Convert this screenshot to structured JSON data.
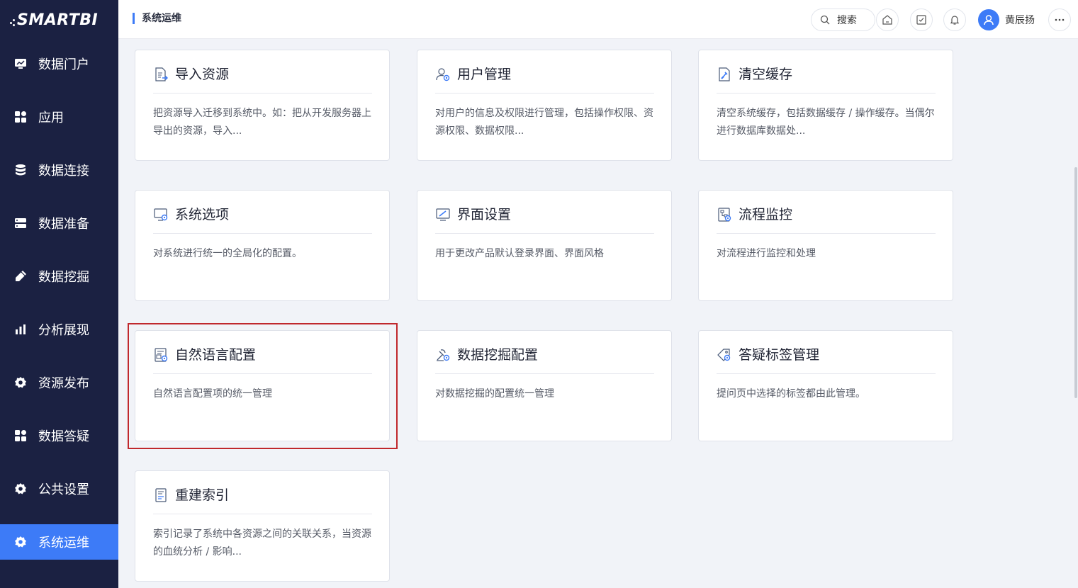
{
  "app": {
    "logo": "SMARTBI"
  },
  "sidebar": {
    "items": [
      {
        "label": "数据门户",
        "icon": "monitor-icon"
      },
      {
        "label": "应用",
        "icon": "grid-icon"
      },
      {
        "label": "数据连接",
        "icon": "database-icon"
      },
      {
        "label": "数据准备",
        "icon": "server-icon"
      },
      {
        "label": "数据挖掘",
        "icon": "pen-icon"
      },
      {
        "label": "分析展现",
        "icon": "bar-chart-icon"
      },
      {
        "label": "资源发布",
        "icon": "gear-icon"
      },
      {
        "label": "数据答疑",
        "icon": "grid-icon"
      },
      {
        "label": "公共设置",
        "icon": "gear-icon"
      },
      {
        "label": "系统运维",
        "icon": "gear-icon",
        "active": true
      }
    ]
  },
  "header": {
    "title": "系统运维",
    "search_label": "搜索",
    "user_name": "黄辰扬"
  },
  "cards": [
    {
      "title": "导入资源",
      "desc": "把资源导入迁移到系统中。如：把从开发服务器上导出的资源，导入...",
      "icon": "import-icon"
    },
    {
      "title": "用户管理",
      "desc": "对用户的信息及权限进行管理，包括操作权限、资源权限、数据权限...",
      "icon": "user-settings-icon"
    },
    {
      "title": "清空缓存",
      "desc": "清空系统缓存，包括数据缓存 / 操作缓存。当偶尔进行数据库数据处...",
      "icon": "clear-cache-icon"
    },
    {
      "title": "系统选项",
      "desc": "对系统进行统一的全局化的配置。",
      "icon": "system-options-icon"
    },
    {
      "title": "界面设置",
      "desc": "用于更改产品默认登录界面、界面风格",
      "icon": "interface-settings-icon"
    },
    {
      "title": "流程监控",
      "desc": "对流程进行监控和处理",
      "icon": "flow-monitor-icon"
    },
    {
      "title": "自然语言配置",
      "desc": "自然语言配置项的统一管理",
      "icon": "nlp-config-icon"
    },
    {
      "title": "数据挖掘配置",
      "desc": "对数据挖掘的配置统一管理",
      "icon": "mining-config-icon"
    },
    {
      "title": "答疑标签管理",
      "desc": "提问页中选择的标签都由此管理。",
      "icon": "tag-manage-icon"
    },
    {
      "title": "重建索引",
      "desc": "索引记录了系统中各资源之间的关联关系，当资源的血统分析 / 影响...",
      "icon": "rebuild-index-icon"
    }
  ],
  "colors": {
    "sidebar_bg": "#1b2142",
    "accent": "#3d7bf7",
    "highlight_border": "#c0282d"
  }
}
